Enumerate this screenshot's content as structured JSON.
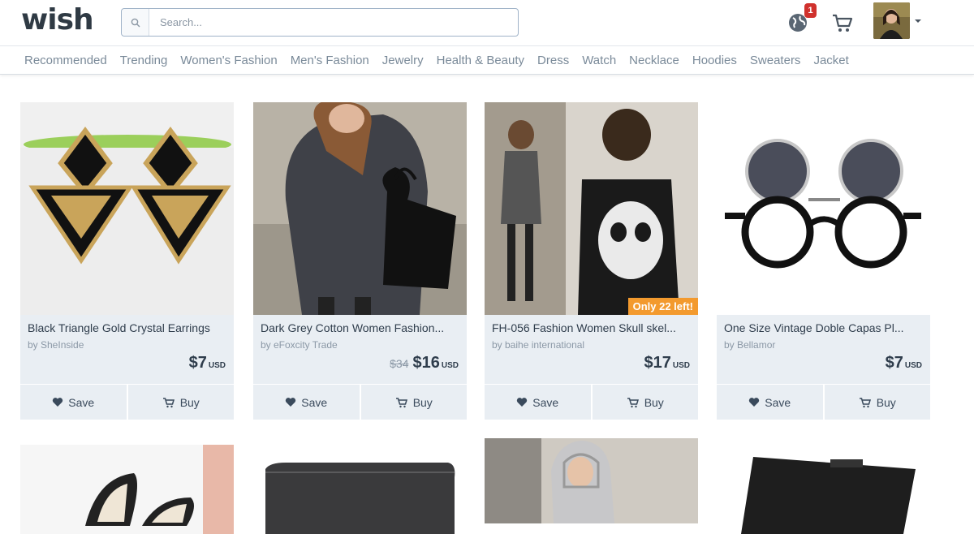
{
  "header": {
    "logo": "wish",
    "search_placeholder": "Search...",
    "notification_count": "1"
  },
  "nav": {
    "categories": [
      "Recommended",
      "Trending",
      "Women's Fashion",
      "Men's Fashion",
      "Jewelry",
      "Health & Beauty",
      "Dress",
      "Watch",
      "Necklace",
      "Hoodies",
      "Sweaters",
      "Jacket"
    ]
  },
  "products": [
    {
      "title": "Black Triangle Gold Crystal Earrings",
      "seller": "by SheInside",
      "old_price": "",
      "price": "$7",
      "currency": "USD",
      "save_label": "Save",
      "buy_label": "Buy",
      "badge": ""
    },
    {
      "title": "Dark Grey Cotton Women Fashion...",
      "seller": "by eFoxcity Trade",
      "old_price": "$34",
      "price": "$16",
      "currency": "USD",
      "save_label": "Save",
      "buy_label": "Buy",
      "badge": ""
    },
    {
      "title": "FH-056 Fashion Women Skull skel...",
      "seller": "by baihe international",
      "old_price": "",
      "price": "$17",
      "currency": "USD",
      "save_label": "Save",
      "buy_label": "Buy",
      "badge": "Only 22 left!"
    },
    {
      "title": "One Size Vintage Doble Capas Pl...",
      "seller": "by Bellamor",
      "old_price": "",
      "price": "$7",
      "currency": "USD",
      "save_label": "Save",
      "buy_label": "Buy",
      "badge": ""
    }
  ],
  "colors": {
    "accent_badge": "#d0312d",
    "stock_badge": "#f39a2e",
    "card_bg": "#e9eef3"
  }
}
